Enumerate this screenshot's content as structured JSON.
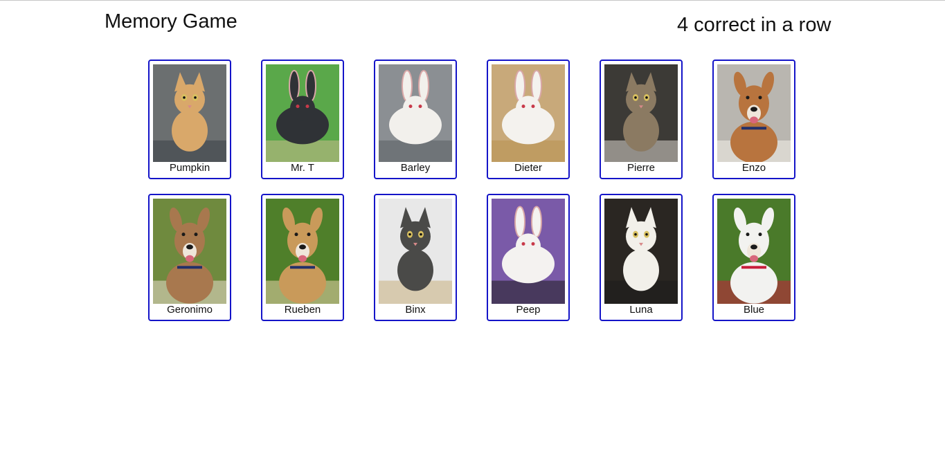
{
  "header": {
    "title": "Memory Game",
    "streak": "4 correct in a row"
  },
  "cards": [
    {
      "name": "Pumpkin",
      "icon": "cat-icon",
      "bg": "#6b6f70",
      "fur": "#d9a86a",
      "accent": "#3a3f47"
    },
    {
      "name": "Mr. T",
      "icon": "rabbit-icon",
      "bg": "#5aa84a",
      "fur": "#2f3236",
      "accent": "#c9b98a"
    },
    {
      "name": "Barley",
      "icon": "rabbit-icon",
      "bg": "#8b8f93",
      "fur": "#f2f0ec",
      "accent": "#5a5e62"
    },
    {
      "name": "Dieter",
      "icon": "rabbit-icon",
      "bg": "#c8a97a",
      "fur": "#f4f2ee",
      "accent": "#b8924e"
    },
    {
      "name": "Pierre",
      "icon": "cat-icon",
      "bg": "#3c3a36",
      "fur": "#8b7a62",
      "accent": "#d8d4cc"
    },
    {
      "name": "Enzo",
      "icon": "dog-icon",
      "bg": "#b9b6b0",
      "fur": "#b8743e",
      "accent": "#f4f0ea"
    },
    {
      "name": "Geronimo",
      "icon": "dog-icon",
      "bg": "#6f8a3e",
      "fur": "#a8784e",
      "accent": "#e9dccc"
    },
    {
      "name": "Rueben",
      "icon": "dog-icon",
      "bg": "#4f7f2a",
      "fur": "#c99a5a",
      "accent": "#e8d2a8"
    },
    {
      "name": "Binx",
      "icon": "cat-icon",
      "bg": "#e8e8e8",
      "fur": "#4a4a48",
      "accent": "#c9b080"
    },
    {
      "name": "Peep",
      "icon": "rabbit-icon",
      "bg": "#7a5aa8",
      "fur": "#f4f2f0",
      "accent": "#1f1f1f"
    },
    {
      "name": "Luna",
      "icon": "cat-icon",
      "bg": "#2a2622",
      "fur": "#f2f0ea",
      "accent": "#1b1b1b"
    },
    {
      "name": "Blue",
      "icon": "dog-icon",
      "bg": "#4a7a2a",
      "fur": "#f2f2f0",
      "accent": "#c81e3c"
    }
  ],
  "colors": {
    "card_border": "#1414c8"
  }
}
